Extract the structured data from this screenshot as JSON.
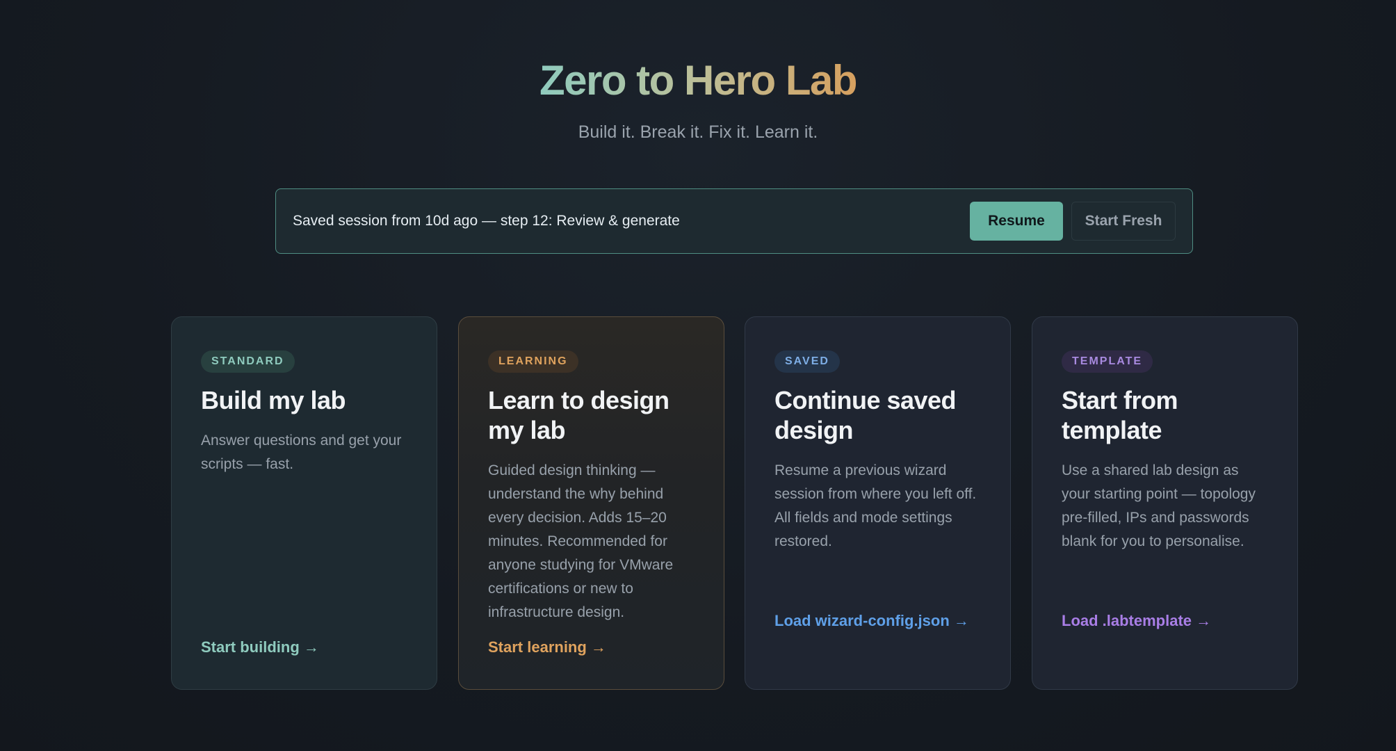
{
  "header": {
    "title": "Zero to Hero Lab",
    "subtitle": "Build it. Break it. Fix it. Learn it."
  },
  "session_banner": {
    "message": "Saved session from 10d ago — step 12: Review & generate",
    "resume_label": "Resume",
    "start_fresh_label": "Start Fresh"
  },
  "cards": [
    {
      "badge": "STANDARD",
      "title": "Build my lab",
      "description": "Answer questions and get your scripts — fast.",
      "link": "Start building →",
      "accent": "#8fcbbe"
    },
    {
      "badge": "LEARNING",
      "title": "Learn to design my lab",
      "description": "Guided design thinking — understand the why behind every decision. Adds 15–20 minutes. Recommended for anyone studying for VMware certifications or new to infrastructure design.",
      "link": "Start learning →",
      "accent": "#e0a35e"
    },
    {
      "badge": "SAVED",
      "title": "Continue saved design",
      "description": "Resume a previous wizard session from where you left off. All fields and mode settings restored.",
      "link": "Load wizard-config.json →",
      "accent": "#5fa0e8"
    },
    {
      "badge": "TEMPLATE",
      "title": "Start from template",
      "description": "Use a shared lab design as your starting point — topology pre-filled, IPs and passwords blank for you to personalise.",
      "link": "Load .labtemplate →",
      "accent": "#a97ee6"
    }
  ]
}
